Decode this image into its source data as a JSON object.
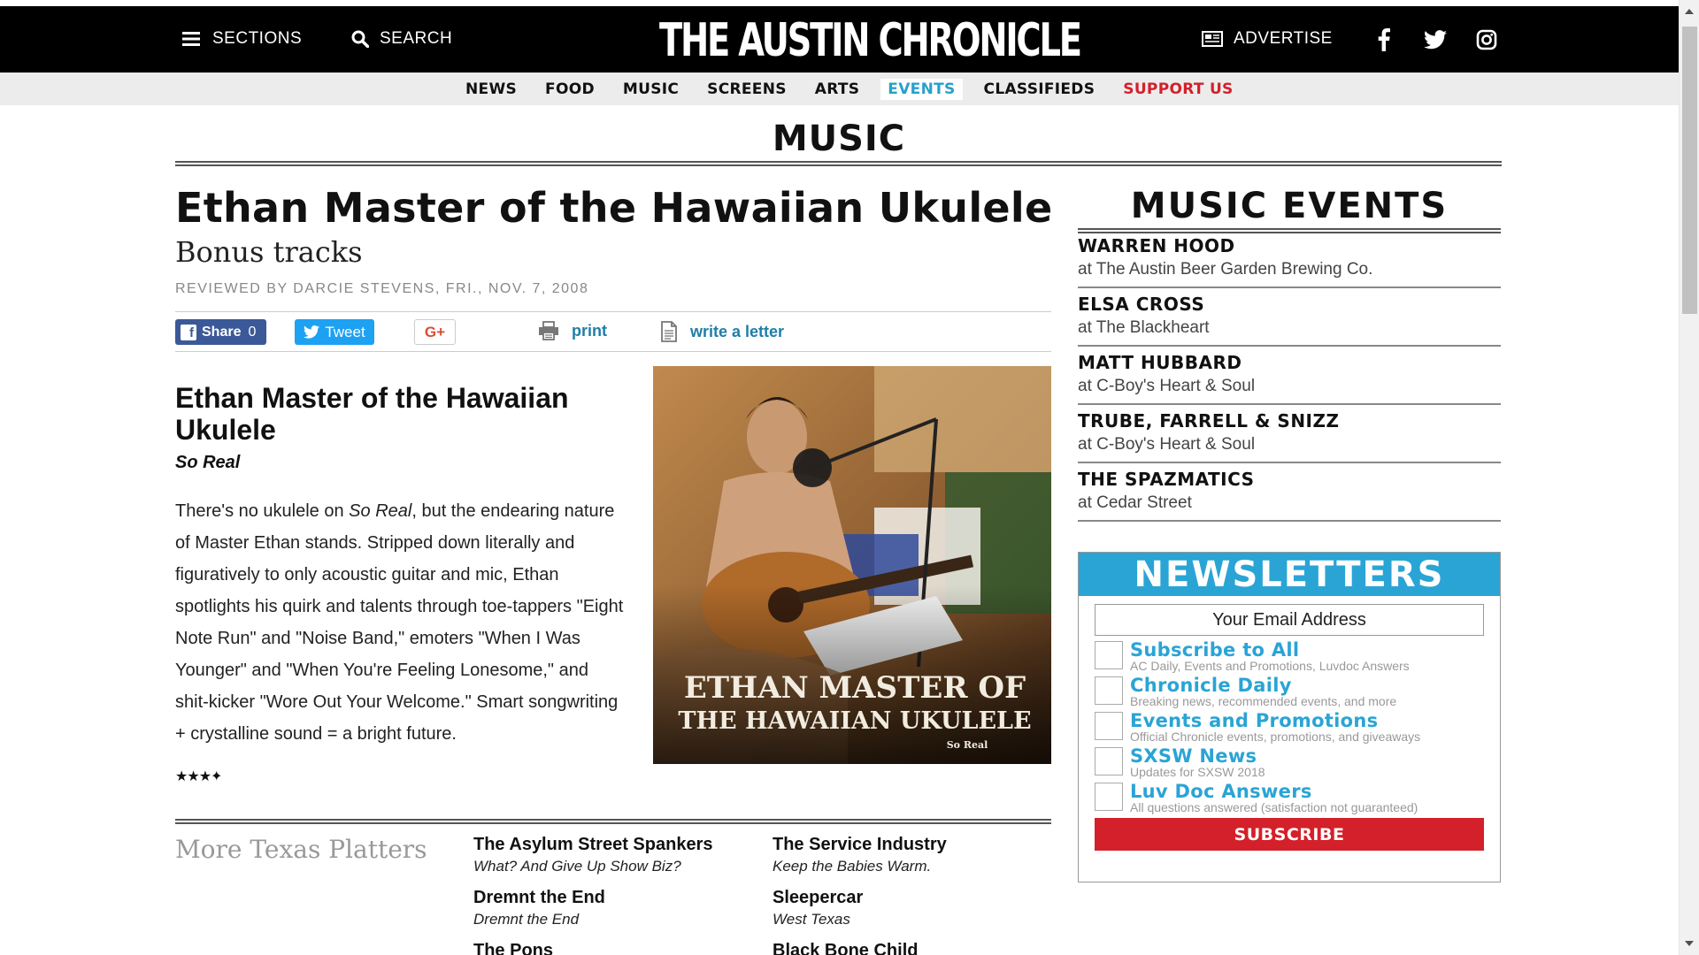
{
  "header": {
    "sections_label": "SECTIONS",
    "search_label": "SEARCH",
    "logo_text": "THE AUSTIN CHRONICLE",
    "advertise_label": "ADVERTISE"
  },
  "nav": {
    "items": [
      "NEWS",
      "FOOD",
      "MUSIC",
      "SCREENS",
      "ARTS",
      "EVENTS",
      "CLASSIFIEDS",
      "SUPPORT US"
    ],
    "active": "EVENTS",
    "accent_color": "#27a0cb",
    "support_color": "#d4202a"
  },
  "section_title": "MUSIC",
  "article": {
    "title": "Ethan Master of the Hawaiian Ukulele",
    "subtitle": "Bonus tracks",
    "byline": "REVIEWED BY DARCIE STEVENS, FRI., NOV. 7, 2008",
    "share": {
      "facebook_label": "Share",
      "facebook_count": "0",
      "tweet_label": "Tweet",
      "gplus_label": "G+",
      "print_label": "print",
      "letter_label": "write a letter"
    },
    "review": {
      "artist": "Ethan Master of the Hawaiian Ukulele",
      "album": "So Real",
      "body_pre": "There's no ukulele on ",
      "body_em": "So Real",
      "body_post": ", but the endearing nature of Master Ethan stands. Stripped down literally and figuratively to only acoustic guitar and mic, Ethan spotlights his quirk and talents through toe-tappers \"Eight Note Run\" and \"Noise Band,\" emoters \"When I Was Younger\" and \"When You're Feeling Lonesome,\" and shit-kicker \"Wore Out Your Welcome.\" Smart songwriting + crystalline sound = a bright future.",
      "stars": "★★★✦",
      "rating": 3.5
    },
    "cover": {
      "line1": "ETHAN MASTER OF",
      "line2": "THE HAWAIIAN UKULELE",
      "line3": "So Real"
    }
  },
  "more": {
    "heading": "More Texas Platters",
    "items": [
      {
        "artist": "The Asylum Street Spankers",
        "album": "What? And Give Up Show Biz?"
      },
      {
        "artist": "The Service Industry",
        "album": "Keep the Babies Warm."
      },
      {
        "artist": "Dremnt the End",
        "album": "Dremnt the End"
      },
      {
        "artist": "Sleepercar",
        "album": "West Texas"
      },
      {
        "artist": "The Pons",
        "album": ""
      },
      {
        "artist": "Black Bone Child",
        "album": ""
      }
    ]
  },
  "sidebar": {
    "title": "MUSIC EVENTS",
    "events": [
      {
        "name": "WARREN HOOD",
        "venue": "at The Austin Beer Garden Brewing Co."
      },
      {
        "name": "ELSA CROSS",
        "venue": "at The Blackheart"
      },
      {
        "name": "MATT HUBBARD",
        "venue": "at C-Boy's Heart & Soul"
      },
      {
        "name": "TRUBE, FARRELL & SNIZZ",
        "venue": "at C-Boy's Heart & Soul"
      },
      {
        "name": "THE SPAZMATICS",
        "venue": "at Cedar Street"
      }
    ]
  },
  "newsletter": {
    "title": "NEWSLETTERS",
    "email_placeholder": "Your Email Address",
    "options": [
      {
        "label": "Subscribe to All",
        "desc": "AC Daily, Events and Promotions, Luvdoc Answers"
      },
      {
        "label": "Chronicle Daily",
        "desc": "Breaking news, recommended events, and more"
      },
      {
        "label": "Events and Promotions",
        "desc": "Official Chronicle events, promotions, and giveaways"
      },
      {
        "label": "SXSW News",
        "desc": "Updates for SXSW 2018"
      },
      {
        "label": "Luv Doc Answers",
        "desc": "All questions answered (satisfaction not guaranteed)"
      }
    ],
    "submit_label": "SUBSCRIBE",
    "accent_color": "#2aa4d5",
    "submit_color": "#d4202a"
  },
  "icons": [
    "hamburger-icon",
    "search-icon",
    "newspaper-icon",
    "facebook-icon",
    "twitter-icon",
    "instagram-icon",
    "print-icon",
    "document-icon"
  ]
}
